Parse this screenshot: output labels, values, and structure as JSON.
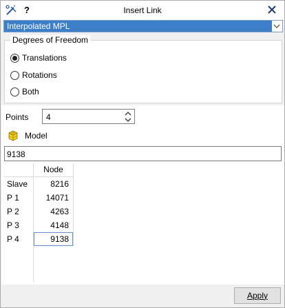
{
  "window": {
    "title": "Insert Link",
    "help_label": "?"
  },
  "link_type": {
    "selected": "Interpolated MPL"
  },
  "dof_group": {
    "title": "Degrees of Freedom",
    "options": [
      {
        "label": "Translations",
        "checked": true
      },
      {
        "label": "Rotations",
        "checked": false
      },
      {
        "label": "Both",
        "checked": false
      }
    ]
  },
  "points": {
    "label": "Points",
    "value": "4"
  },
  "model": {
    "label": "Model",
    "entity_value": "9138"
  },
  "table": {
    "column_header": "Node",
    "rows": [
      {
        "label": "Slave",
        "node": "8216"
      },
      {
        "label": "P 1",
        "node": "14071"
      },
      {
        "label": "P 2",
        "node": "4263"
      },
      {
        "label": "P 3",
        "node": "4148"
      },
      {
        "label": "P 4",
        "node": "9138"
      }
    ]
  },
  "footer": {
    "apply_label": "Apply"
  },
  "colors": {
    "selection_blue": "#3c7fc8",
    "window_bg": "#f0f0f0"
  },
  "icons": {
    "title": "tools-wand-icon",
    "close": "close-icon",
    "model": "cube-icon"
  }
}
